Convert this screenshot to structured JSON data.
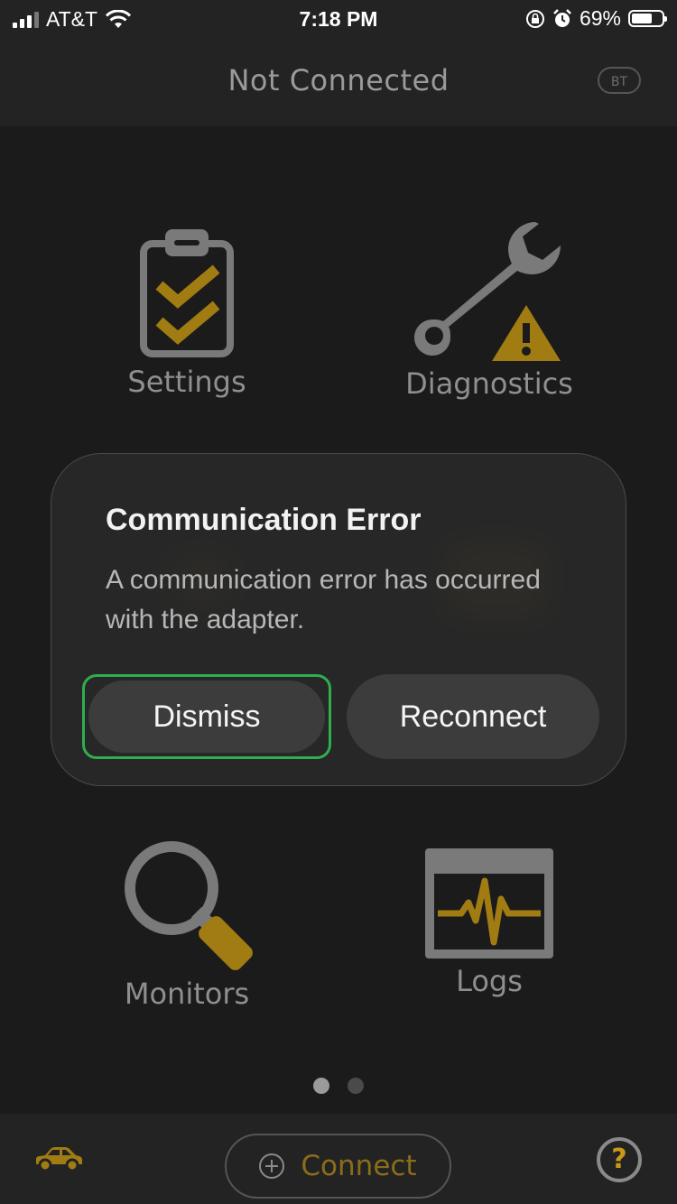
{
  "status_bar": {
    "carrier": "AT&T",
    "time": "7:18 PM",
    "battery": "69%",
    "battery_level": 0.69
  },
  "header": {
    "title": "Not Connected",
    "bt_badge": "BT"
  },
  "tiles": {
    "settings": "Settings",
    "diagnostics": "Diagnostics",
    "monitors": "Monitors",
    "logs": "Logs"
  },
  "dialog": {
    "title": "Communication Error",
    "message": "A communication error has occurred with the adapter.",
    "dismiss_label": "Dismiss",
    "reconnect_label": "Reconnect"
  },
  "pager": {
    "pages": 2,
    "active": 1
  },
  "bottom_bar": {
    "connect_label": "Connect",
    "help_symbol": "?"
  },
  "colors": {
    "accent": "#8a6d1a",
    "accent_bright": "#c99a15",
    "focus_ring": "#2fae4f",
    "background": "#1b1b1b"
  },
  "icons": [
    "signal-icon",
    "wifi-icon",
    "orientation-lock-icon",
    "alarm-icon",
    "battery-icon",
    "clipboard-check-icon",
    "wrench-warning-icon",
    "magnifier-icon",
    "waveform-monitor-icon",
    "car-icon",
    "plus-circle-icon",
    "help-icon"
  ]
}
